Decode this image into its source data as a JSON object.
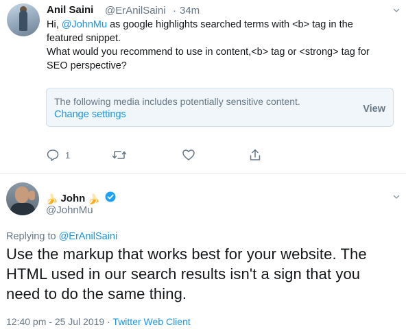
{
  "tweet1": {
    "author_name": "Anil Saini",
    "author_handle": "@ErAnilSaini",
    "separator": "·",
    "time": "34m",
    "text_prefix": "Hi, ",
    "mention": "@JohnMu",
    "text_body": " as google highlights searched terms with <b> tag in the\nfeatured snippet.\nWhat would you recommend to use in content,<b> tag or <strong> tag for\nSEO perspective?",
    "sensitive_notice": "The following media includes potentially sensitive content.",
    "change_settings": "Change settings",
    "view_label": "View",
    "reply_count": "1"
  },
  "tweet2": {
    "author_name": "John",
    "name_emoji_before": "🍌",
    "name_emoji_after": "🍌",
    "author_handle": "@JohnMu",
    "replying_prefix": "Replying to ",
    "replying_to": "@ErAnilSaini",
    "text": "Use the markup that works best for your website. The HTML used in our search results isn't a sign that you need to do the same thing.",
    "timestamp": "12:40 pm - 25 Jul 2019",
    "footer_sep": " · ",
    "client": "Twitter Web Client"
  },
  "icons": [
    "chevron-down-icon",
    "reply-icon",
    "retweet-icon",
    "like-icon",
    "share-icon",
    "verified-badge-icon"
  ],
  "colors": {
    "link": "#1b95e0",
    "secondary": "#657786",
    "primary": "#14171a",
    "divider": "#e6ecf0"
  }
}
